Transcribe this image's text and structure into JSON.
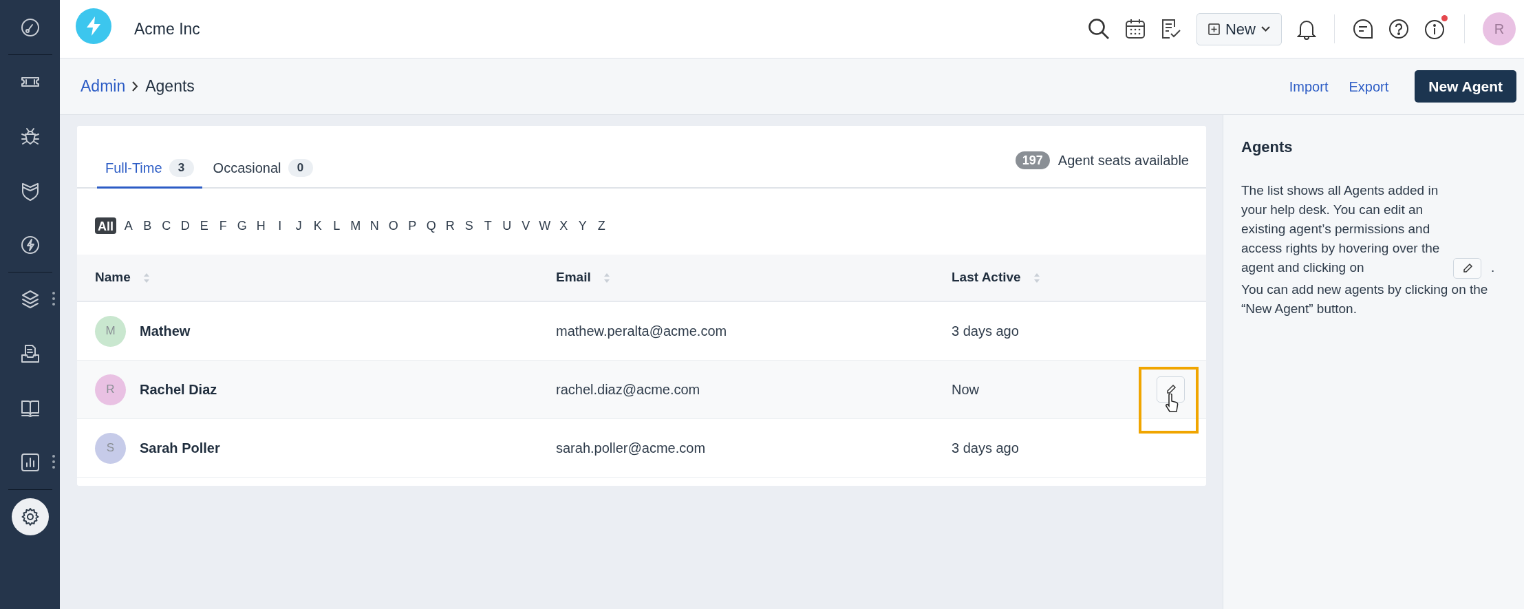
{
  "sidebar": {
    "groups": [
      [
        {
          "selected": false,
          "menu": false
        }
      ],
      [
        {
          "selected": false,
          "menu": false
        },
        {
          "selected": false,
          "menu": false
        },
        {
          "selected": false,
          "menu": false
        },
        {
          "selected": false,
          "menu": false
        }
      ],
      [
        {
          "selected": false,
          "menu": true
        },
        {
          "selected": false,
          "menu": false
        },
        {
          "selected": false,
          "menu": false
        },
        {
          "selected": false,
          "menu": true
        }
      ],
      [
        {
          "selected": true,
          "menu": false
        }
      ]
    ]
  },
  "topbar": {
    "company": "Acme Inc",
    "new_button": "New",
    "notification_dot": true,
    "avatar": "R"
  },
  "breadcrumb": [
    "Admin",
    "Agents"
  ],
  "actions": {
    "import": "Import",
    "export": "Export",
    "new_agent": "New Agent"
  },
  "tabs": [
    {
      "label": "Full-Time",
      "count": "3",
      "selected": true
    },
    {
      "label": "Occasional",
      "count": "0",
      "selected": false
    }
  ],
  "seats": {
    "count": "197",
    "label": "Agent seats available"
  },
  "alphabet": [
    {
      "label": "All",
      "selected": true
    },
    {
      "label": "A",
      "selected": false
    },
    {
      "label": "B",
      "selected": false
    },
    {
      "label": "C",
      "selected": false
    },
    {
      "label": "D",
      "selected": false
    },
    {
      "label": "E",
      "selected": false
    },
    {
      "label": "F",
      "selected": false
    },
    {
      "label": "G",
      "selected": false
    },
    {
      "label": "H",
      "selected": false
    },
    {
      "label": "I",
      "selected": false
    },
    {
      "label": "J",
      "selected": false
    },
    {
      "label": "K",
      "selected": false
    },
    {
      "label": "L",
      "selected": false
    },
    {
      "label": "M",
      "selected": false
    },
    {
      "label": "N",
      "selected": false
    },
    {
      "label": "O",
      "selected": false
    },
    {
      "label": "P",
      "selected": false
    },
    {
      "label": "Q",
      "selected": false
    },
    {
      "label": "R",
      "selected": false
    },
    {
      "label": "S",
      "selected": false
    },
    {
      "label": "T",
      "selected": false
    },
    {
      "label": "U",
      "selected": false
    },
    {
      "label": "V",
      "selected": false
    },
    {
      "label": "W",
      "selected": false
    },
    {
      "label": "X",
      "selected": false
    },
    {
      "label": "Y",
      "selected": false
    },
    {
      "label": "Z",
      "selected": false
    }
  ],
  "table": {
    "columns": [
      "Name",
      "Email",
      "Last Active"
    ],
    "rows": [
      {
        "initial": "M",
        "color": "#c9e7cf",
        "name": "Mathew",
        "email": "mathew.peralta@acme.com",
        "last_active": "3 days ago",
        "hovered": false
      },
      {
        "initial": "R",
        "color": "#e9c1e3",
        "name": "Rachel Diaz",
        "email": "rachel.diaz@acme.com",
        "last_active": "Now",
        "hovered": true
      },
      {
        "initial": "S",
        "color": "#c6cbe9",
        "name": "Sarah Poller",
        "email": "sarah.poller@acme.com",
        "last_active": "3 days ago",
        "hovered": false
      }
    ]
  },
  "help": {
    "title": "Agents",
    "text_before_icon": "The list shows all Agents added in your help desk. You can edit an existing agent’s permissions and access rights by hovering over the agent and clicking on",
    "text_after_icon": ".",
    "text_2": "You can add new agents by clicking on the “New Agent” button."
  }
}
